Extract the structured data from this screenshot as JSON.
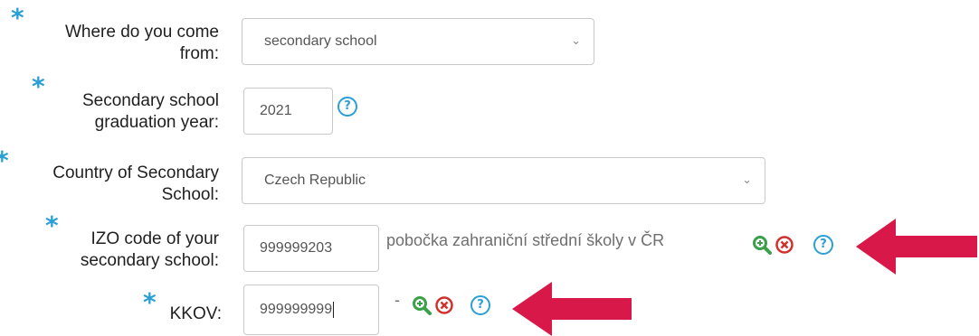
{
  "form": {
    "origin": {
      "label": "Where do you come from:",
      "label_line1": "Where do you come",
      "label_line2": "from:",
      "value": "secondary school"
    },
    "graduation_year": {
      "label_line1": "Secondary school",
      "label_line2": "graduation year:",
      "value": "2021"
    },
    "country": {
      "label_line1": "Country of Secondary",
      "label_line2": "School:",
      "value": "Czech Republic"
    },
    "izo": {
      "label_line1": "IZO code of your",
      "label_line2": "secondary school:",
      "value": "999999203",
      "school_name": "pobočka zahraniční střední školy v ČR"
    },
    "kkov": {
      "label": "KKOV:",
      "value": "999999999",
      "separator": "-"
    }
  },
  "icons": {
    "required": "*",
    "help": "?",
    "help_icon": "question-circle-icon",
    "search_icon": "magnify-plus-icon",
    "clear_icon": "x-circle-icon",
    "dropdown_icon": "chevron-down-icon",
    "annotation_icon": "arrow-left-icon"
  },
  "colors": {
    "required_star": "#2a9fd6",
    "help": "#2a9fd6",
    "search": "#3aa14a",
    "clear": "#d0312d",
    "arrow": "#d81848"
  }
}
